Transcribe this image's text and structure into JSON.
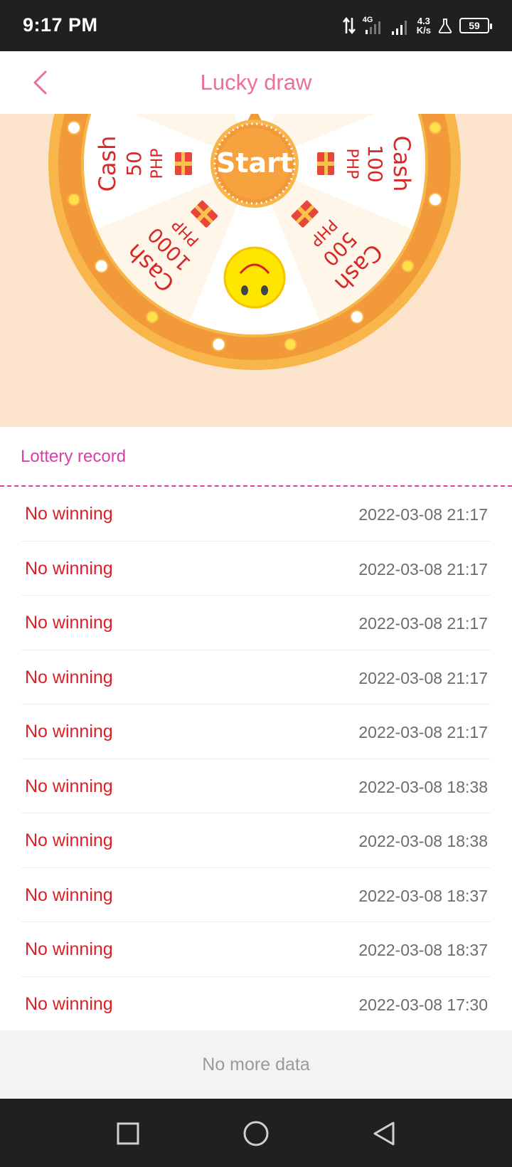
{
  "status_bar": {
    "time": "9:17 PM",
    "network": "4G",
    "speed_value": "4.3",
    "speed_unit": "K/s",
    "battery": "59"
  },
  "header": {
    "title": "Lucky draw",
    "back_icon": "chevron-left-icon"
  },
  "wheel": {
    "start_label": "Start",
    "prizes": [
      {
        "word": "Cash",
        "amount": "50",
        "unit": "PHP"
      },
      {
        "word": "Cash",
        "amount": "100",
        "unit": "PHP"
      },
      {
        "word": "Cash",
        "amount": "500",
        "unit": "PHP"
      },
      {
        "word": "Cash",
        "amount": "1000",
        "unit": "PHP"
      }
    ],
    "colors": {
      "rim": "#f29a3a",
      "accent": "#f7b54a",
      "light_segment": "#fff6ea",
      "white_segment": "#ffffff",
      "text": "#d82828"
    }
  },
  "record": {
    "title": "Lottery record",
    "rows": [
      {
        "status": "No winning",
        "time": "2022-03-08 21:17"
      },
      {
        "status": "No winning",
        "time": "2022-03-08 21:17"
      },
      {
        "status": "No winning",
        "time": "2022-03-08 21:17"
      },
      {
        "status": "No winning",
        "time": "2022-03-08 21:17"
      },
      {
        "status": "No winning",
        "time": "2022-03-08 21:17"
      },
      {
        "status": "No winning",
        "time": "2022-03-08 18:38"
      },
      {
        "status": "No winning",
        "time": "2022-03-08 18:38"
      },
      {
        "status": "No winning",
        "time": "2022-03-08 18:37"
      },
      {
        "status": "No winning",
        "time": "2022-03-08 18:37"
      },
      {
        "status": "No winning",
        "time": "2022-03-08 17:30"
      }
    ],
    "footer": "No more data"
  },
  "nav": {
    "recents_icon": "square-icon",
    "home_icon": "circle-icon",
    "back_icon": "triangle-back-icon"
  },
  "colors": {
    "title_pink": "#ec6f98",
    "record_magenta": "#d63fa4",
    "no_winning_red": "#dc1f26",
    "wheel_background": "#fbe3cc"
  }
}
